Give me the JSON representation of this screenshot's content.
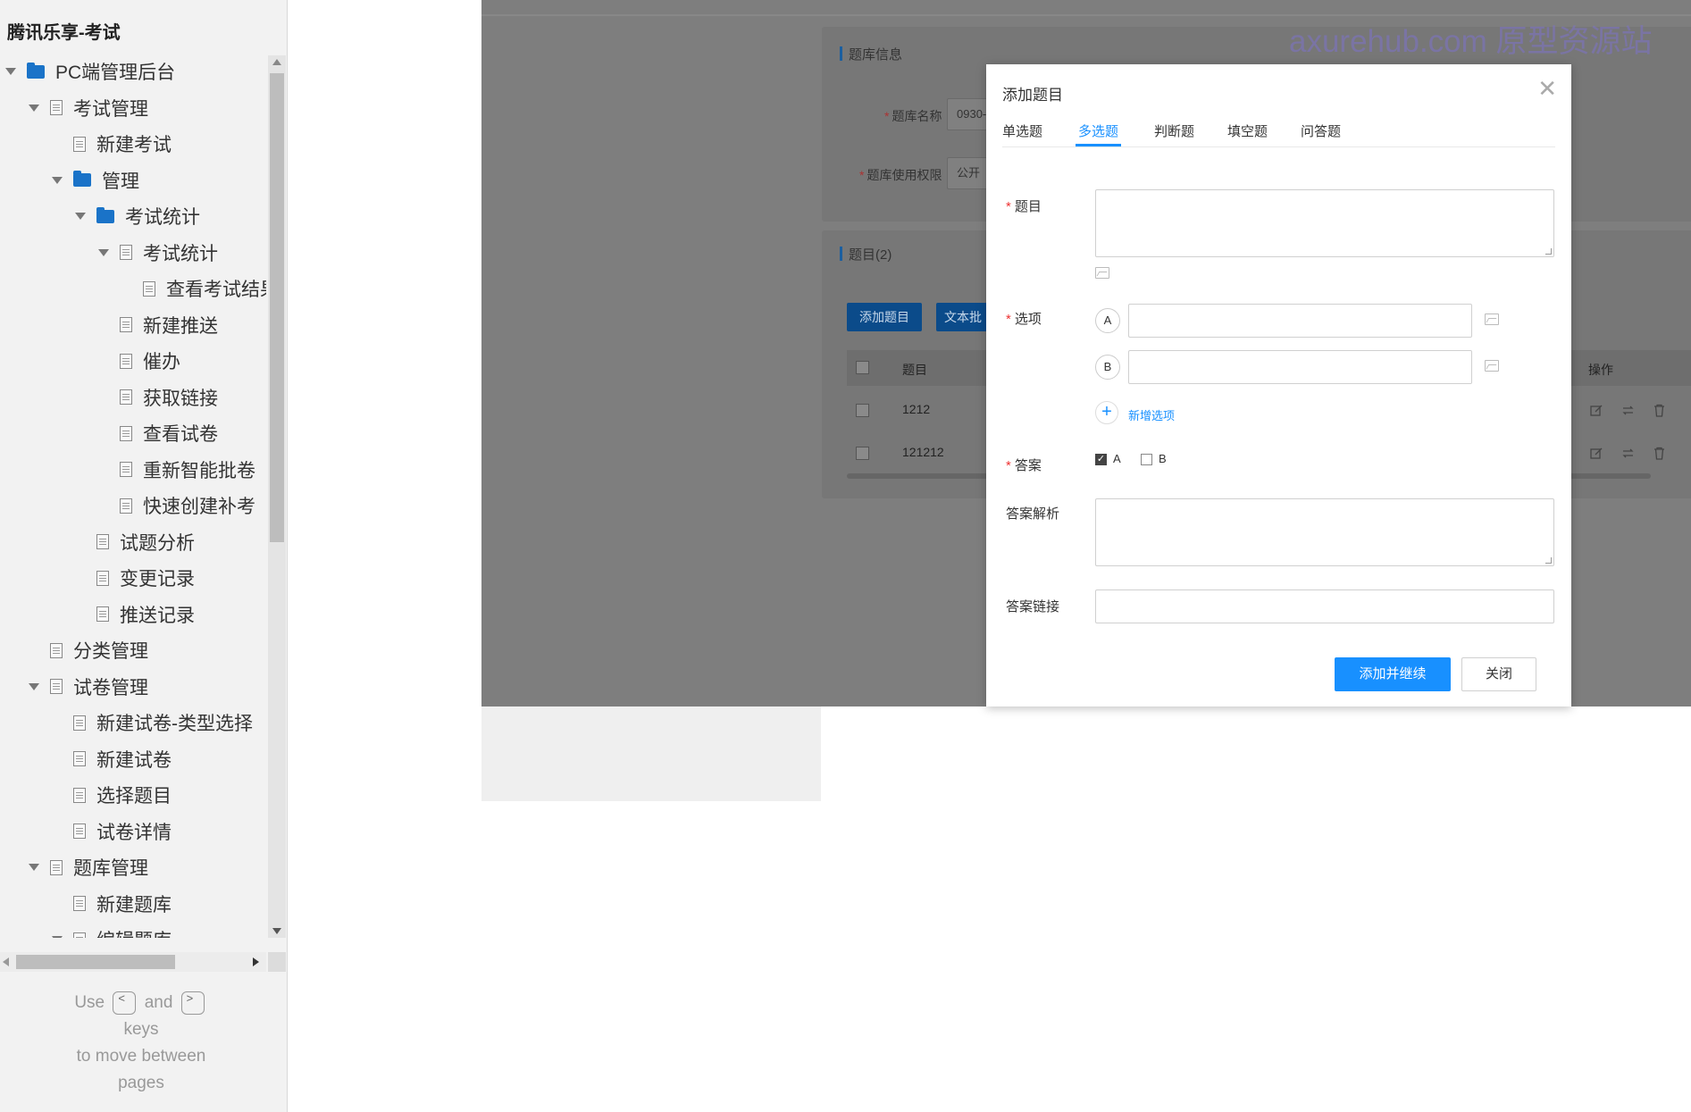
{
  "sidebar": {
    "title": "腾讯乐享-考试",
    "tree": [
      {
        "label": "PC端管理后台",
        "icon": "folder",
        "arrow": true
      },
      {
        "label": "考试管理",
        "icon": "page",
        "arrow": true
      },
      {
        "label": "新建考试",
        "icon": "page",
        "arrow": false
      },
      {
        "label": "管理",
        "icon": "folder",
        "arrow": true
      },
      {
        "label": "考试统计",
        "icon": "folder",
        "arrow": true
      },
      {
        "label": "考试统计",
        "icon": "page",
        "arrow": true
      },
      {
        "label": "查看考试结果",
        "icon": "page",
        "arrow": false
      },
      {
        "label": "新建推送",
        "icon": "page",
        "arrow": false
      },
      {
        "label": "催办",
        "icon": "page",
        "arrow": false
      },
      {
        "label": "获取链接",
        "icon": "page",
        "arrow": false
      },
      {
        "label": "查看试卷",
        "icon": "page",
        "arrow": false
      },
      {
        "label": "重新智能批卷",
        "icon": "page",
        "arrow": false
      },
      {
        "label": "快速创建补考",
        "icon": "page",
        "arrow": false
      },
      {
        "label": "试题分析",
        "icon": "page",
        "arrow": false
      },
      {
        "label": "变更记录",
        "icon": "page",
        "arrow": false
      },
      {
        "label": "推送记录",
        "icon": "page",
        "arrow": false
      },
      {
        "label": "分类管理",
        "icon": "page",
        "arrow": false
      },
      {
        "label": "试卷管理",
        "icon": "page",
        "arrow": true
      },
      {
        "label": "新建试卷-类型选择",
        "icon": "page",
        "arrow": false
      },
      {
        "label": "新建试卷",
        "icon": "page",
        "arrow": false
      },
      {
        "label": "选择题目",
        "icon": "page",
        "arrow": false
      },
      {
        "label": "试卷详情",
        "icon": "page",
        "arrow": false
      },
      {
        "label": "题库管理",
        "icon": "page",
        "arrow": true
      },
      {
        "label": "新建题库",
        "icon": "page",
        "arrow": false
      },
      {
        "label": "编辑题库",
        "icon": "page",
        "arrow": true
      }
    ],
    "help": {
      "use": "Use",
      "and": "and",
      "keys": "keys",
      "move": "to move between",
      "pages": "pages",
      "prev_key": "<",
      "next_key": ">"
    }
  },
  "background": {
    "watermark": "axurehub.com 原型资源站",
    "info_title": "题库信息",
    "name_label": "题库名称",
    "name_value": "0930-",
    "perm_label": "题库使用权限",
    "perm_value": "公开",
    "questions_title": "题目(2)",
    "add_button": "添加题目",
    "text_import_button": "文本批",
    "col_title": "题目",
    "col_ops": "操作",
    "rows": [
      "1212",
      "121212"
    ]
  },
  "modal": {
    "title": "添加题目",
    "tabs": [
      "单选题",
      "多选题",
      "判断题",
      "填空题",
      "问答题"
    ],
    "active_tab": 1,
    "question_label": "题目",
    "options_label": "选项",
    "option_letters": [
      "A",
      "B"
    ],
    "add_option": "新增选项",
    "answer_label": "答案",
    "answer_choices": [
      {
        "label": "A",
        "checked": true
      },
      {
        "label": "B",
        "checked": false
      }
    ],
    "analysis_label": "答案解析",
    "link_label": "答案链接",
    "submit_button": "添加并继续",
    "close_button": "关闭",
    "required_mark": "*"
  }
}
